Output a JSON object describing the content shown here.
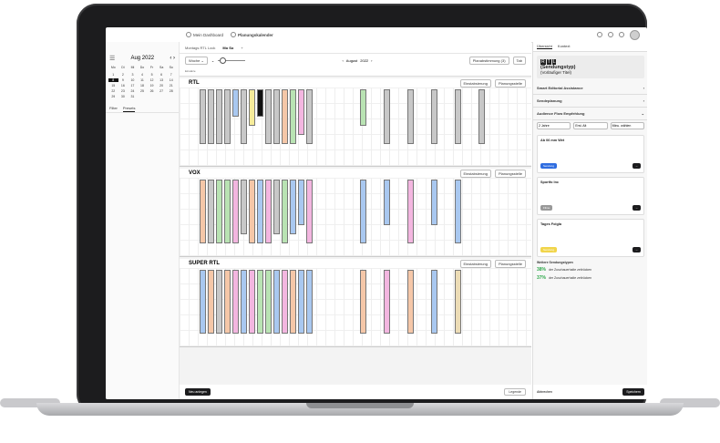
{
  "header": {
    "breadcrumb_1": "Mein Dashboard",
    "breadcrumb_2": "Planungskalender"
  },
  "calendar": {
    "month_label": "Aug 2022",
    "weekdays": [
      "Mo",
      "Di",
      "Mi",
      "Do",
      "Fr",
      "Sa",
      "So"
    ],
    "days": [
      "",
      "",
      "",
      "",
      "",
      "",
      "",
      "1",
      "2",
      "3",
      "4",
      "5",
      "6",
      "7",
      "8",
      "9",
      "10",
      "11",
      "12",
      "13",
      "14",
      "15",
      "16",
      "17",
      "18",
      "19",
      "20",
      "21",
      "22",
      "23",
      "24",
      "25",
      "26",
      "27",
      "28",
      "29",
      "30",
      "31",
      "",
      "",
      "",
      ""
    ],
    "selected_day": "8"
  },
  "filter_tabs": [
    "Filter",
    "Presets"
  ],
  "main_tabs": [
    "Montags RTL Lock",
    "Mo So"
  ],
  "toolbar": {
    "view_select": "Woche",
    "week_label": "August",
    "week_year": "2022",
    "plan_button": "Planabstimmung (3)",
    "tab_button": "Tab"
  },
  "time_row_label": "Einsätze",
  "channels": [
    {
      "name": "RTL",
      "actions": [
        "Einstabsierung",
        "Planungsstelle"
      ]
    },
    {
      "name": "VOX",
      "actions": [
        "Einstabsierung",
        "Planungsstelle"
      ]
    },
    {
      "name": "SUPER RTL",
      "actions": [
        "Einstabsierung",
        "Planungsstelle"
      ]
    }
  ],
  "footer": {
    "left_button": "Neu anlegen",
    "legend_button": "Legende"
  },
  "right_panel": {
    "tabs": [
      "Übersicht",
      "Kontext"
    ],
    "card_title": "(Sendungstyp)",
    "card_subtitle": "(Vorläufiger Titel)",
    "sections": [
      "Smart Editorial Assistance",
      "Sendeplanung",
      "Audience Flow Empfehlung"
    ],
    "select_labels": [
      "2 Jahre",
      "Erst. Alt",
      "Minu. wählen"
    ],
    "blocks": [
      {
        "title": "Ab 06 mm Wet",
        "pill": "Sendung"
      },
      {
        "title": "Sportfo Inc",
        "pill": "Filme"
      },
      {
        "title": "Tages Folgla",
        "pill": "Sendung"
      }
    ],
    "weitere_title": "Weitere Sendungstypen",
    "weitere": [
      {
        "pct": "38%",
        "text": "der Zuschauerhalte zeitrücken"
      },
      {
        "pct": "37%",
        "text": "der Zuschauerhalte zeitrücken"
      }
    ],
    "footer_left": "Abbrechen",
    "footer_right": "Speichern"
  },
  "colors": {
    "gray": "#c8c8c8",
    "blue": "#a9c8f0",
    "orange": "#f5c7a8",
    "green": "#b9e3b3",
    "pink": "#f3b6e0",
    "yellow": "#f6ec9a",
    "beige": "#ecdcb6",
    "black": "#111111"
  }
}
